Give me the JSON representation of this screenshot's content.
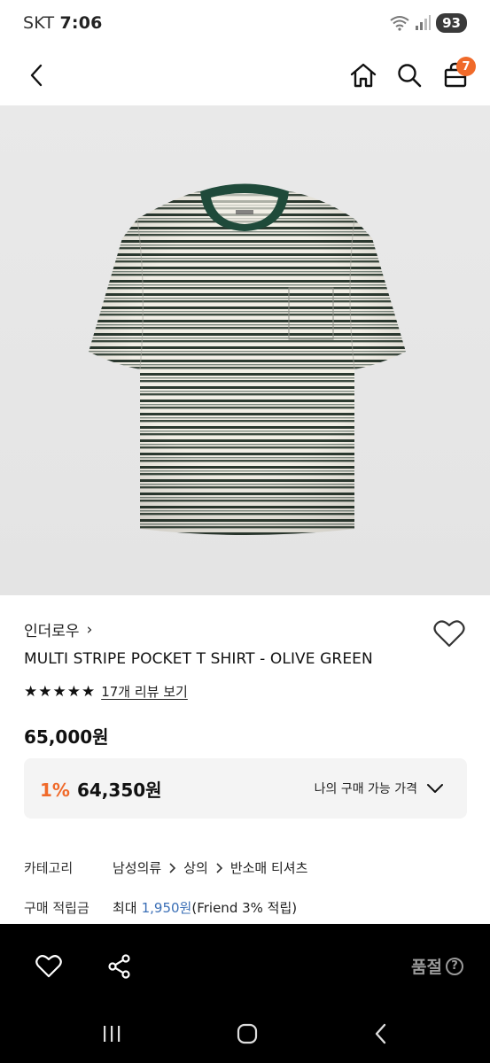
{
  "status_bar": {
    "carrier": "SKT",
    "time": "7:06",
    "battery": "93"
  },
  "header": {
    "cart_count": "7"
  },
  "product": {
    "brand": "인더로우",
    "brand_chevron": "›",
    "name": "MULTI STRIPE POCKET T SHIRT - OLIVE GREEN",
    "stars": "★★★★★",
    "review_link": "17개 리뷰 보기",
    "price": "65,000원",
    "discount_rate": "1%",
    "discount_price": "64,350원",
    "my_price_label": "나의 구매 가능 가격"
  },
  "details": {
    "category_label": "카테고리",
    "category_path": [
      "남성의류",
      "상의",
      "반소매 티셔츠"
    ],
    "points_label": "구매 적립금",
    "points_prefix": "최대",
    "points_amount": "1,950원",
    "points_suffix": "(Friend 3% 적립)"
  },
  "action_bar": {
    "soldout_label": "품절",
    "help_glyph": "?"
  },
  "colors": {
    "accent": "#f06a2a",
    "link_blue": "#3b6fb6",
    "shirt_green": "#1f4a3a"
  }
}
